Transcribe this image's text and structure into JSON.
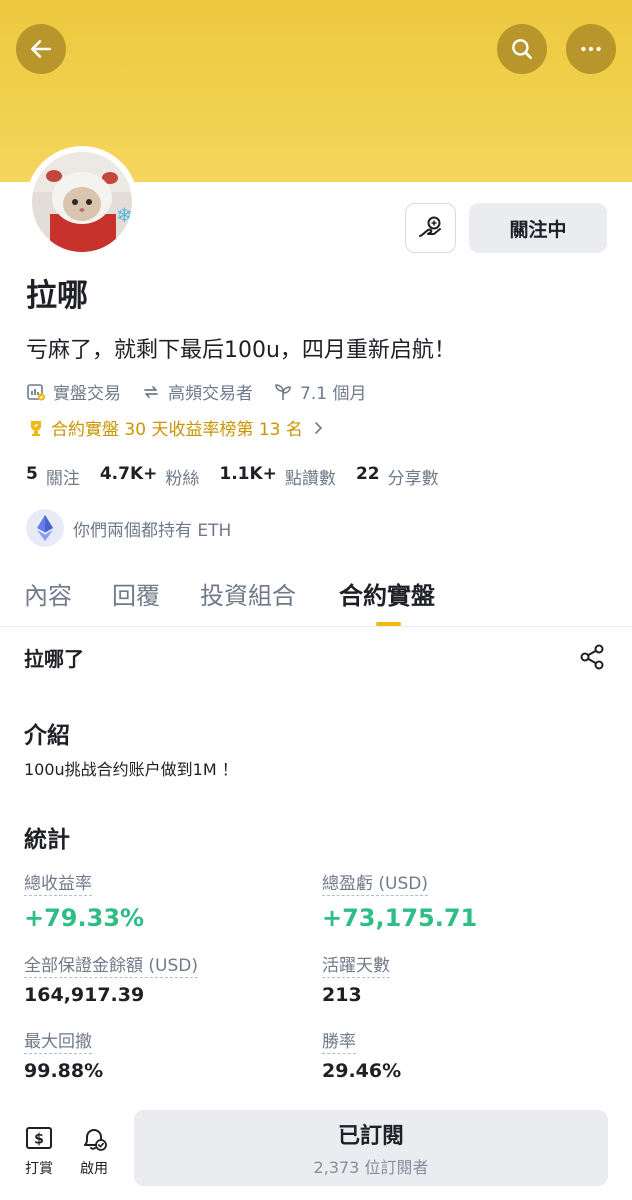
{
  "colors": {
    "header": "#f5d55c",
    "accent": "#f0b90b",
    "positive": "#2ebd85",
    "rank": "#c99400"
  },
  "header": {
    "icons": [
      "back-arrow-icon",
      "search-icon",
      "more-icon"
    ]
  },
  "profile": {
    "name": "拉哪",
    "bio": "亏麻了，就剩下最后100u，四月重新启航！",
    "follow_button": "關注中",
    "tags": [
      {
        "icon": "chart-badge-icon",
        "label": "實盤交易"
      },
      {
        "icon": "repeat-icon",
        "label": "高頻交易者"
      },
      {
        "icon": "sprout-icon",
        "label": "7.1 個月"
      }
    ],
    "rank_text": "合約實盤 30 天收益率榜第 13 名",
    "counts": [
      {
        "value": "5",
        "label": "關注"
      },
      {
        "value": "4.7K+",
        "label": "粉絲"
      },
      {
        "value": "1.1K+",
        "label": "點讚數"
      },
      {
        "value": "22",
        "label": "分享數"
      }
    ],
    "shared_holding": "你們兩個都持有 ETH"
  },
  "tabs": [
    {
      "label": "內容",
      "active": false
    },
    {
      "label": "回覆",
      "active": false
    },
    {
      "label": "投資組合",
      "active": false
    },
    {
      "label": "合約實盤",
      "active": true
    }
  ],
  "account": {
    "name": "拉哪了",
    "intro_title": "介紹",
    "intro_text": "100u挑战合约账户做到1M ！",
    "stats_title": "統計",
    "stats": {
      "total_roi": {
        "label": "總收益率",
        "value": "+79.33%"
      },
      "total_pnl": {
        "label": "總盈虧 (USD)",
        "value": "+73,175.71"
      },
      "margin_balance": {
        "label": "全部保證金餘額 (USD)",
        "value": "164,917.39"
      },
      "active_days": {
        "label": "活躍天數",
        "value": "213"
      },
      "max_drawdown": {
        "label": "最大回撤",
        "value": "99.88%"
      },
      "win_rate": {
        "label": "勝率",
        "value": "29.46%"
      }
    }
  },
  "bottom_bar": {
    "tip_label": "打賞",
    "enable_label": "啟用",
    "subscribe_label": "已訂閱",
    "subscribers": "2,373 位訂閱者"
  }
}
